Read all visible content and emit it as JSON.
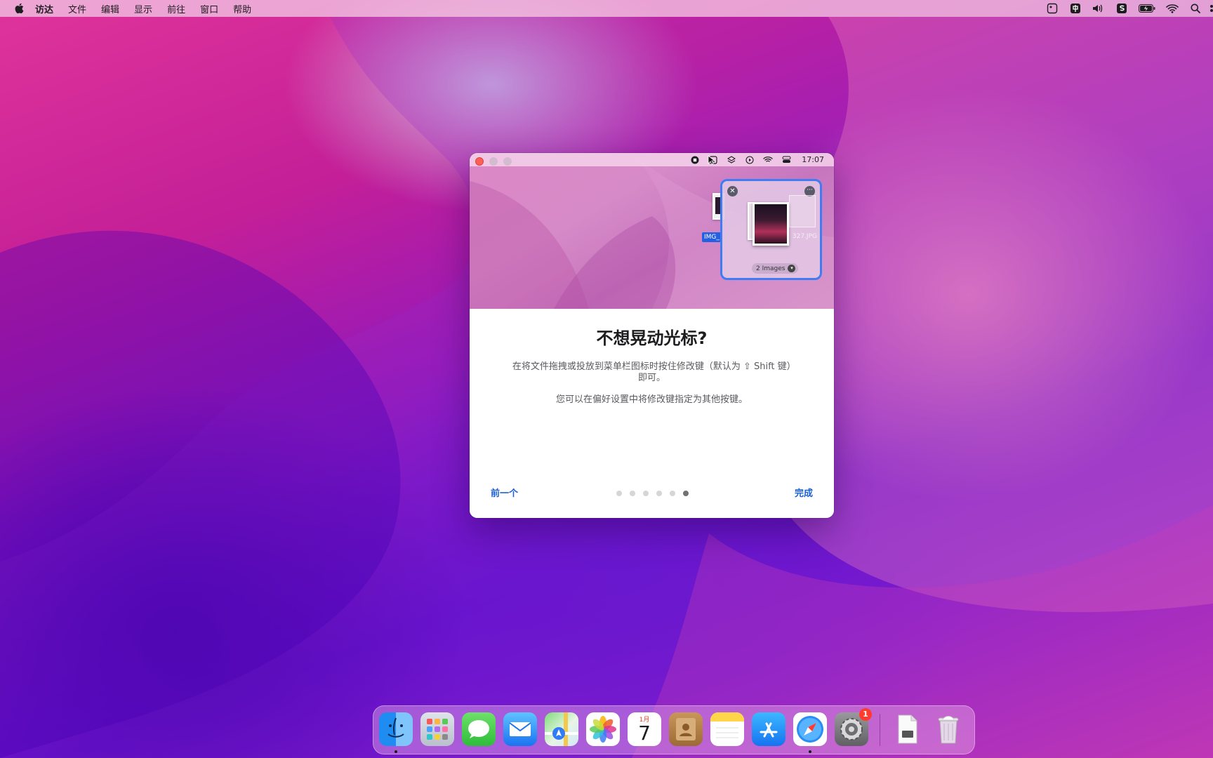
{
  "menubar": {
    "items": [
      "访达",
      "文件",
      "编辑",
      "显示",
      "前往",
      "窗口",
      "帮助"
    ]
  },
  "window": {
    "preview_bar": {
      "time": "17:07"
    },
    "shelf": {
      "count_label": "2 Images",
      "dragged_file_label": "IMG_",
      "ghost_file_label": "327.JPG"
    },
    "title": "不想晃动光标?",
    "description_line": "在将文件拖拽或投放到菜单栏图标时按住修改键（默认为 ⇧ Shift 键）即可。",
    "description_hint": "您可以在偏好设置中将修改键指定为其他按键。",
    "prev_button": "前一个",
    "done_button": "完成",
    "pagination": {
      "total": 6,
      "current": 6
    }
  },
  "dock": {
    "calendar": {
      "month": "1月",
      "day": "7"
    },
    "settings_badge": "1"
  },
  "colors": {
    "accent": "#1a5fd6",
    "shelf_border": "#3f7cf2",
    "close_button": "#ff5f57",
    "badge": "#ff3b30"
  }
}
